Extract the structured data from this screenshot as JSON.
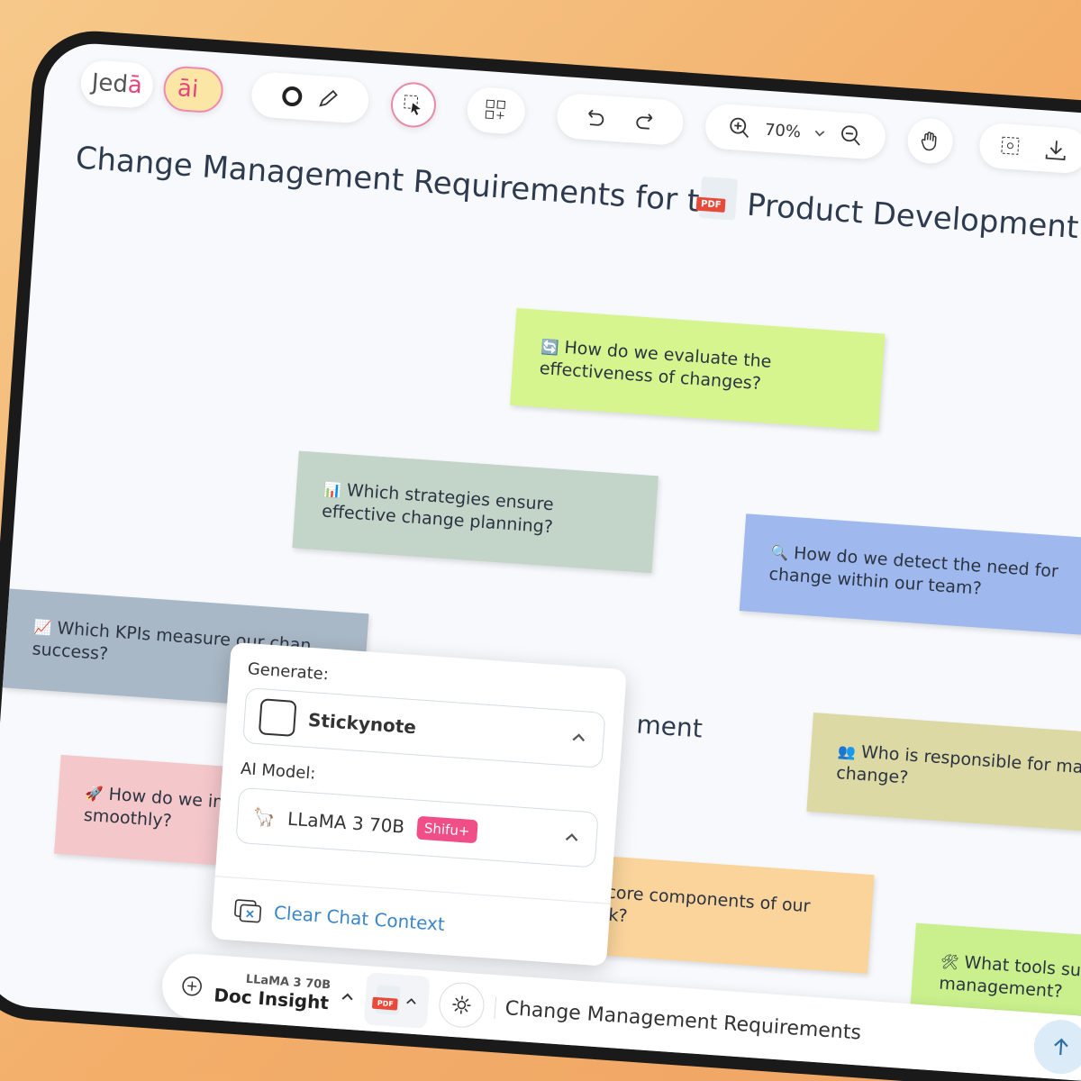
{
  "app": {
    "logo_text": "Jed",
    "logo_accent": "ā"
  },
  "toolbar": {
    "ai_label": "āi",
    "zoom": "70%",
    "accent_color": "#e6457a"
  },
  "canvas": {
    "title": "Change Management Requirements for the Product Development Team a",
    "pdf_tag": "PDF",
    "subheading_fragment": "ment",
    "notes": [
      {
        "icon": "🔄",
        "text": "How do we evaluate the effectiveness of changes?",
        "color": "#d7f58f"
      },
      {
        "icon": "📊",
        "text": "Which strategies ensure effective change planning?",
        "color": "#c2d5c8"
      },
      {
        "icon": "🔍",
        "text": "How do we detect the need for change within our team?",
        "color": "#9fb9ee"
      },
      {
        "icon": "📈",
        "text": "Which KPIs measure our chan success?",
        "color": "#a9b8c6"
      },
      {
        "icon": "👥",
        "text": "Who is responsible for mana change?",
        "color": "#dcd9a4"
      },
      {
        "icon": "🚀",
        "text": "How do we imp smoothly?",
        "color": "#f4c7cb"
      },
      {
        "icon": "",
        "text": "e the core components of our nework?",
        "color": "#fad49b"
      },
      {
        "icon": "🛠",
        "text": "What tools sup management?",
        "color": "#c9f08d"
      }
    ]
  },
  "popup": {
    "generate_label": "Generate:",
    "generate_value": "Stickynote",
    "model_label": "AI Model:",
    "model_value": "LLaMA 3 70B",
    "model_badge": "Shifu+",
    "clear_label": "Clear Chat Context"
  },
  "bottom_bar": {
    "model": "LLaMA 3 70B",
    "mode": "Doc Insight",
    "pdf_tag": "PDF",
    "query": "Change Management Requirements"
  }
}
